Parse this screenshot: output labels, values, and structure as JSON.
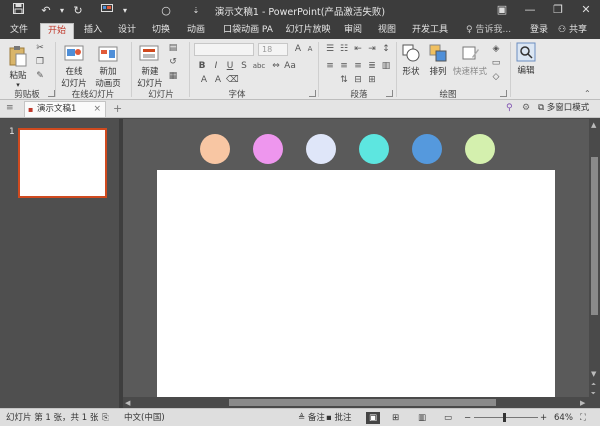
{
  "titlebar": {
    "title": "演示文稿1 - PowerPoint(产品激活失败)",
    "save_icon": "save-icon",
    "undo_icon": "undo-icon",
    "redo_icon": "redo-icon"
  },
  "tabs": [
    {
      "label": "文件"
    },
    {
      "label": "开始",
      "active": true
    },
    {
      "label": "插入"
    },
    {
      "label": "设计"
    },
    {
      "label": "切换"
    },
    {
      "label": "动画"
    },
    {
      "label": "口袋动画 PA"
    },
    {
      "label": "幻灯片放映"
    },
    {
      "label": "审阅"
    },
    {
      "label": "视图"
    },
    {
      "label": "开发工具"
    }
  ],
  "tellme": "告诉我...",
  "login": "登录",
  "share": "共享",
  "ribbon": {
    "clipboard": {
      "paste": "粘贴",
      "label": "剪贴板"
    },
    "online": {
      "online_slide": "在线",
      "online_slide2": "幻灯片",
      "new_online": "新加",
      "new_online2": "动画页",
      "label": "在线幻灯片"
    },
    "slides": {
      "new_slide": "新建",
      "new_slide2": "幻灯片",
      "label": "幻灯片"
    },
    "font": {
      "font_name": "",
      "font_size": "18",
      "label": "字体"
    },
    "paragraph": {
      "label": "段落"
    },
    "drawing": {
      "shape": "形状",
      "arrange": "排列",
      "quick_style": "快速样式",
      "label": "绘图"
    },
    "editing": {
      "edit": "编辑"
    }
  },
  "doc_tab": "演示文稿1",
  "multiwindow": "多窗口模式",
  "slide_number": "1",
  "circles": [
    {
      "color": "#f8c6a3"
    },
    {
      "color": "#ee96ee"
    },
    {
      "color": "#dfe6f9"
    },
    {
      "color": "#5de6e0"
    },
    {
      "color": "#5599dd"
    },
    {
      "color": "#d4f0ae"
    }
  ],
  "status": {
    "slide_info": "幻灯片 第 1 张，共 1 张",
    "language": "中文(中国)",
    "notes": "备注",
    "comments": "批注",
    "zoom": "64%"
  }
}
